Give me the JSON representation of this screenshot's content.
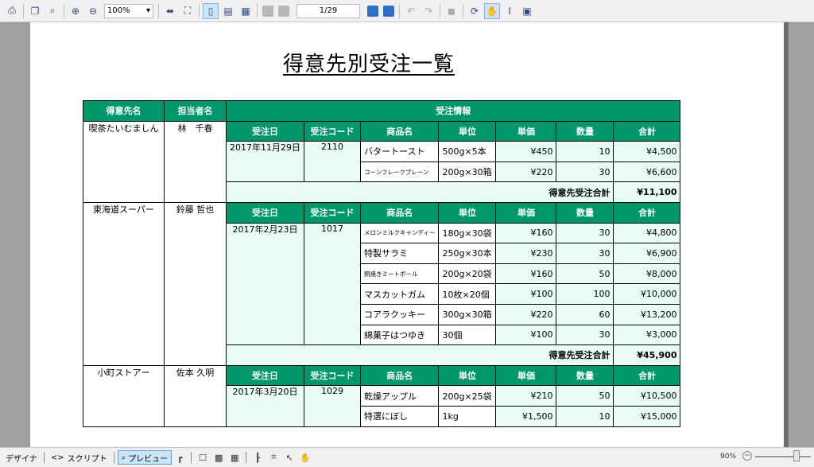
{
  "toolbar": {
    "zoom_value": "100%",
    "page_indicator": "1/29"
  },
  "document": {
    "title": "得意先別受注一覧",
    "headers": {
      "customer": "得意先名",
      "staff": "担当者名",
      "order_info": "受注情報",
      "order_date": "受注日",
      "order_code": "受注コード",
      "product": "商品名",
      "unit": "単位",
      "price": "単価",
      "qty": "数量",
      "total": "合計"
    },
    "total_label": "得意先受注合計",
    "groups": [
      {
        "customer": "喫茶たいむましん",
        "staff": "林　千春",
        "order_date": "2017年11月29日",
        "order_code": "2110",
        "items": [
          {
            "product": "バタートースト",
            "unit": "500g×5本",
            "price": "¥450",
            "qty": "10",
            "total": "¥4,500"
          },
          {
            "product": "コーンフレークプレーン",
            "unit": "200g×30箱",
            "price": "¥220",
            "qty": "30",
            "total": "¥6,600"
          }
        ],
        "group_total": "¥11,100"
      },
      {
        "customer": "東海道スーパー",
        "staff": "鈴藤 哲也",
        "order_date": "2017年2月23日",
        "order_code": "1017",
        "items": [
          {
            "product": "メロンミルクキャンディー",
            "unit": "180g×30袋",
            "price": "¥160",
            "qty": "30",
            "total": "¥4,800"
          },
          {
            "product": "特製サラミ",
            "unit": "250g×30本",
            "price": "¥230",
            "qty": "30",
            "total": "¥6,900"
          },
          {
            "product": "照焼きミートボール",
            "unit": "200g×20袋",
            "price": "¥160",
            "qty": "50",
            "total": "¥8,000"
          },
          {
            "product": "マスカットガム",
            "unit": "10枚×20個",
            "price": "¥100",
            "qty": "100",
            "total": "¥10,000"
          },
          {
            "product": "コアラクッキー",
            "unit": "300g×30箱",
            "price": "¥220",
            "qty": "60",
            "total": "¥13,200"
          },
          {
            "product": "綿菓子はつゆき",
            "unit": "30個",
            "price": "¥100",
            "qty": "30",
            "total": "¥3,000"
          }
        ],
        "group_total": "¥45,900"
      },
      {
        "customer": "小町ストアー",
        "staff": "佐本 久明",
        "order_date": "2017年3月20日",
        "order_code": "1029",
        "items": [
          {
            "product": "乾燥アップル",
            "unit": "200g×25袋",
            "price": "¥210",
            "qty": "50",
            "total": "¥10,500"
          },
          {
            "product": "特選にぼし",
            "unit": "1kg",
            "price": "¥1,500",
            "qty": "10",
            "total": "¥15,000"
          }
        ]
      }
    ]
  },
  "bottombar": {
    "designer_label": "デザイナ",
    "script_label": "スクリプト",
    "preview_label": "プレビュー",
    "zoom_percent": "90%"
  },
  "colors": {
    "header_green": "#00986a",
    "cell_tint": "#e8fbf7"
  }
}
